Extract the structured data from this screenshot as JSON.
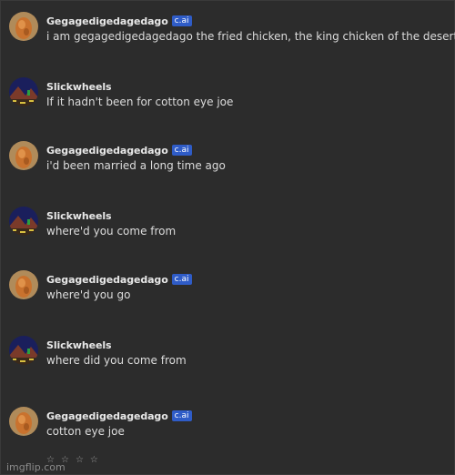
{
  "messages": [
    {
      "author": "Gegagedigedagedago",
      "badge": "c.ai",
      "text": "i am gegagedigedagedago the fried chicken, the king chicken of the desert",
      "avatar_icon": "fried-chicken-avatar-icon"
    },
    {
      "author": "Slickwheels",
      "badge": "",
      "text": "If it hadn't been for cotton eye joe",
      "avatar_icon": "pixel-landscape-avatar-icon"
    },
    {
      "author": "Gegagedigedagedago",
      "badge": "c.ai",
      "text": "i'd been married a long time ago",
      "avatar_icon": "fried-chicken-avatar-icon"
    },
    {
      "author": "Slickwheels",
      "badge": "",
      "text": "where'd you come from",
      "avatar_icon": "pixel-landscape-avatar-icon"
    },
    {
      "author": "Gegagedigedagedago",
      "badge": "c.ai",
      "text": "where'd you go",
      "avatar_icon": "fried-chicken-avatar-icon"
    },
    {
      "author": "Slickwheels",
      "badge": "",
      "text": "where did you come from",
      "avatar_icon": "pixel-landscape-avatar-icon"
    },
    {
      "author": "Gegagedigedagedago",
      "badge": "c.ai",
      "text": "cotton eye joe",
      "avatar_icon": "fried-chicken-avatar-icon"
    }
  ],
  "rating": {
    "icon": "star-icon",
    "stars": [
      "☆",
      "☆",
      "☆",
      "☆"
    ]
  },
  "watermark": "imgflip.com",
  "colors": {
    "background": "#2c2c2c",
    "badge": "#2f5cc7",
    "name": "#e8e8e8",
    "text": "#dcdcdc"
  }
}
